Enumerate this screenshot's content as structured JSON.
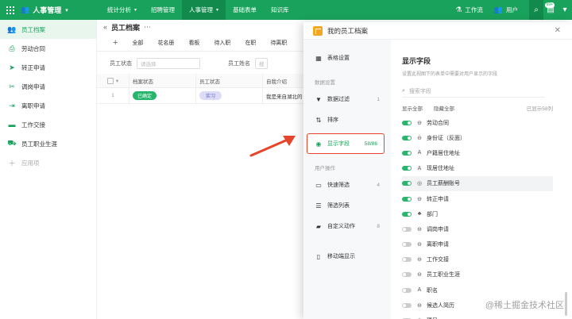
{
  "topbar": {
    "app_title": "人事管理",
    "nav": [
      {
        "label": "统计分析",
        "caret": true
      },
      {
        "label": "招聘管理",
        "caret": false
      },
      {
        "label": "人事管理",
        "caret": true
      },
      {
        "label": "基础表单",
        "caret": false
      },
      {
        "label": "知识库",
        "caret": false
      }
    ],
    "workflow_label": "工作流",
    "users_label": "用户",
    "badge_count": "99+"
  },
  "sidebar": {
    "items": [
      {
        "label": "员工档案",
        "icon": "people-icon"
      },
      {
        "label": "劳动合同",
        "icon": "print-icon"
      },
      {
        "label": "转正申请",
        "icon": "send-icon"
      },
      {
        "label": "调岗申请",
        "icon": "shuffle-icon"
      },
      {
        "label": "离职申请",
        "icon": "exit-icon"
      },
      {
        "label": "工作交接",
        "icon": "list-icon"
      },
      {
        "label": "员工职业生涯",
        "icon": "truck-icon"
      },
      {
        "label": "应用项",
        "icon": "plus-icon"
      }
    ]
  },
  "main": {
    "title": "员工档案",
    "views": [
      "全部",
      "花名册",
      "看板",
      "待入职",
      "在职",
      "待离职"
    ],
    "filters": {
      "status_label": "员工状态",
      "status_placeholder": "请选择",
      "name_label": "员工姓名",
      "name_placeholder": "搜"
    },
    "table": {
      "headers": [
        "档案状态",
        "员工状态",
        "自我介绍"
      ],
      "rows": [
        {
          "index": "1",
          "archive_status": "已确定",
          "employee_status": "实习",
          "intro": "我是来自湖北的"
        }
      ]
    }
  },
  "modal": {
    "title": "我的员工档案",
    "left": {
      "table_settings": "表格设置",
      "data_section": "数据设置",
      "data_filter": "数据过滤",
      "data_filter_count": "1",
      "sort": "排序",
      "display_fields": "显示字段",
      "display_fields_count": "58/86",
      "user_ops_section": "用户操作",
      "quick_filter": "快速筛选",
      "quick_filter_count": "4",
      "filter_list": "筛选列表",
      "custom_actions": "自定义动作",
      "custom_actions_count": "8",
      "mobile_display": "移动端显示"
    },
    "right": {
      "title": "显示字段",
      "subtitle": "设置此视图下的表单中需要对用户显示的字段",
      "search_placeholder": "搜索字段",
      "show_all": "显示全部",
      "hide_all": "隐藏全部",
      "shown_count": "已显示58列",
      "fields": [
        {
          "label": "劳动合同",
          "on": true,
          "icon": "link-icon"
        },
        {
          "label": "身份证（反面）",
          "on": true,
          "icon": "link-icon"
        },
        {
          "label": "户籍居住地址",
          "on": true,
          "icon": "text-icon"
        },
        {
          "label": "现居住地址",
          "on": true,
          "icon": "text-icon"
        },
        {
          "label": "员工薪酬账号",
          "on": true,
          "icon": "circle-icon"
        },
        {
          "label": "转正申请",
          "on": true,
          "icon": "link-icon"
        },
        {
          "label": "部门",
          "on": true,
          "icon": "org-icon"
        },
        {
          "label": "调岗申请",
          "on": false,
          "icon": "link-icon"
        },
        {
          "label": "离职申请",
          "on": false,
          "icon": "link-icon"
        },
        {
          "label": "工作交接",
          "on": false,
          "icon": "link-icon"
        },
        {
          "label": "员工职业生涯",
          "on": false,
          "icon": "link-icon"
        },
        {
          "label": "职名",
          "on": false,
          "icon": "text-icon"
        },
        {
          "label": "候选人简历",
          "on": false,
          "icon": "link-icon"
        },
        {
          "label": "项目",
          "on": false,
          "icon": "link-icon"
        }
      ]
    }
  },
  "watermark": "@稀土掘金技术社区",
  "colors": {
    "brand": "#19a25b",
    "highlight_box": "#e8442b",
    "arrow": "#e8442b"
  }
}
